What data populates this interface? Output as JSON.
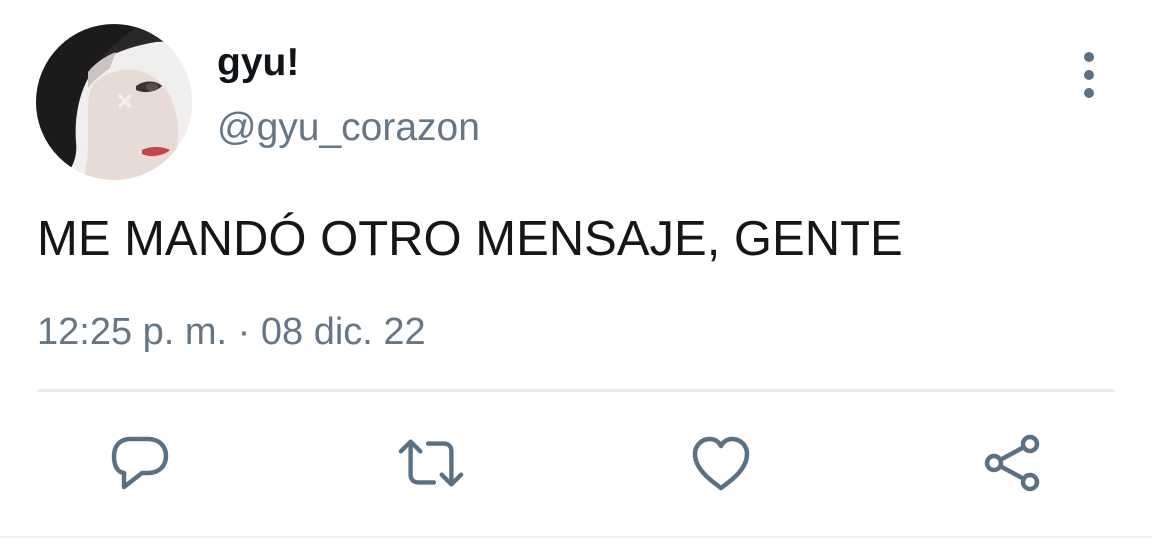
{
  "tweet": {
    "author": {
      "display_name": "gyu!",
      "handle": "@gyu_corazon"
    },
    "text": "ME MANDÓ OTRO MENSAJE, GENTE",
    "timestamp": "12:25 p. m. · 08 dic. 22"
  },
  "icons": {
    "more": "more-vertical-icon",
    "reply": "reply-icon",
    "retweet": "retweet-icon",
    "like": "heart-icon",
    "share": "share-icon"
  },
  "colors": {
    "text_primary": "#14171a",
    "text_secondary": "#657786",
    "icon": "#5b7083",
    "divider": "#e6ecf0"
  }
}
